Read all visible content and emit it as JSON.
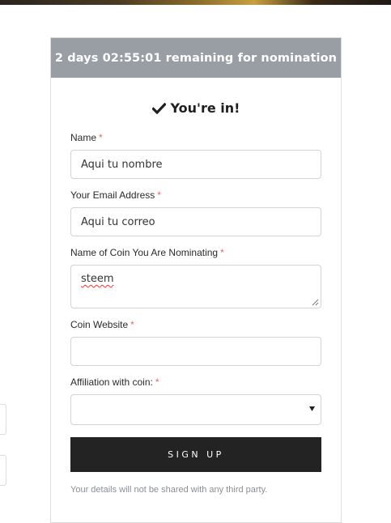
{
  "header": {
    "countdown": "2 days 02:55:01 remaining for nomination"
  },
  "status": {
    "text": "You're in!",
    "icon": "check-icon"
  },
  "form": {
    "name": {
      "label": "Name",
      "required_mark": "*",
      "value": "Aqui tu nombre"
    },
    "email": {
      "label": "Your Email Address",
      "required_mark": "*",
      "value": "Aqui tu correo"
    },
    "coin_name": {
      "label": "Name of Coin You Are Nominating",
      "required_mark": "*",
      "value": "steem"
    },
    "coin_website": {
      "label": "Coin Website",
      "required_mark": "*",
      "value": ""
    },
    "affiliation": {
      "label": "Affiliation with coin:",
      "required_mark": "*",
      "selected": ""
    },
    "submit_label": "SIGN UP",
    "privacy_note": "Your details will not be shared with any third party."
  },
  "colors": {
    "header_bg": "#989ea4",
    "button_bg": "#232323",
    "required": "#e0686a"
  }
}
